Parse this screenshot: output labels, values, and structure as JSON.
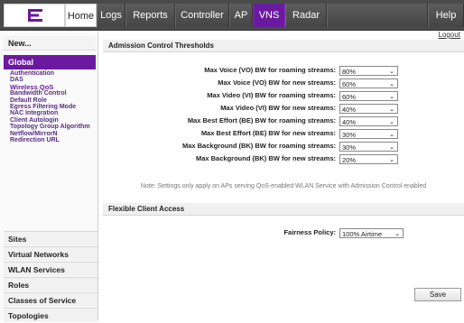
{
  "topbar": {
    "logo_icon": "extreme-networks-logo",
    "tabs": [
      "Home",
      "Logs",
      "Reports",
      "Controller",
      "AP",
      "VNS",
      "Radar"
    ],
    "active_tab": "VNS",
    "help": "Help",
    "logout": "Logout"
  },
  "sidebar": {
    "new": "New...",
    "global": "Global",
    "global_items": [
      "Authentication",
      "DAS",
      "Wireless QoS",
      "Bandwidth Control",
      "Default Role",
      "Egress Filtering Mode",
      "NAC Integration",
      "Client Autologin",
      "Topology Group Algorithm",
      "Netflow/MirrorN",
      "Redirection URL"
    ],
    "current_item": "Wireless QoS",
    "sections": [
      "Sites",
      "Virtual Networks",
      "WLAN Services",
      "Roles",
      "Classes of Service",
      "Topologies"
    ]
  },
  "admission": {
    "title": "Admission Control Thresholds",
    "rows": [
      {
        "label": "Max Voice (VO) BW for roaming streams:",
        "value": "80%"
      },
      {
        "label": "Max Voice (VO) BW for new streams:",
        "value": "60%"
      },
      {
        "label": "Max Video (VI) BW for roaming streams:",
        "value": "60%"
      },
      {
        "label": "Max Video (VI) BW for new streams:",
        "value": "40%"
      },
      {
        "label": "Max Best Effort (BE) BW for roaming streams:",
        "value": "40%"
      },
      {
        "label": "Max Best Effort (BE) BW for new streams:",
        "value": "30%"
      },
      {
        "label": "Max Background (BK) BW for roaming streams:",
        "value": "30%"
      },
      {
        "label": "Max Background (BK) BW for new streams:",
        "value": "20%"
      }
    ],
    "note": "Note: Settings only apply on APs serving QoS-enabled WLAN Service with Admission Control enabled"
  },
  "flexible": {
    "title": "Flexible Client Access",
    "fairness_label": "Fairness Policy:",
    "fairness_value": "100% Airtime"
  },
  "save_label": "Save",
  "colors": {
    "accent": "#6a1aa0",
    "topbar": "#4a4a4a"
  }
}
